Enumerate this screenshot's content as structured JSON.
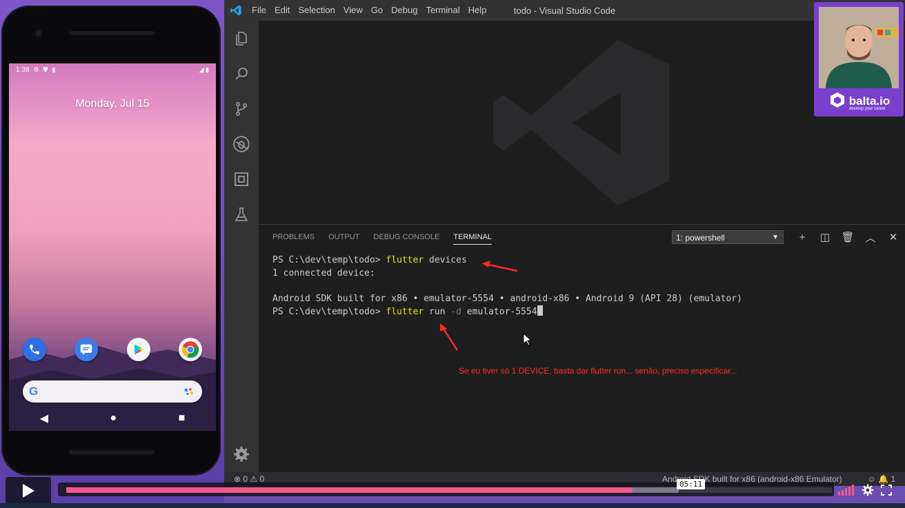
{
  "phone": {
    "status_time": "1:38",
    "date": "Monday, Jul 15",
    "apps": [
      {
        "name": "phone-app-icon",
        "color": "#2f6fe0"
      },
      {
        "name": "messages-app-icon",
        "color": "#3c7bea"
      },
      {
        "name": "play-store-app-icon",
        "color": "#f4f4f4"
      },
      {
        "name": "chrome-app-icon",
        "color": "#f4f4f4"
      }
    ],
    "search_logo": "G"
  },
  "vscode": {
    "menu": [
      "File",
      "Edit",
      "Selection",
      "View",
      "Go",
      "Debug",
      "Terminal",
      "Help"
    ],
    "window_title": "todo - Visual Studio Code",
    "panel_tabs": [
      "PROBLEMS",
      "OUTPUT",
      "DEBUG CONSOLE",
      "TERMINAL"
    ],
    "active_tab": "TERMINAL",
    "terminal_select": "1: powershell",
    "terminal": {
      "line1_prompt": "PS C:\\dev\\temp\\todo> ",
      "line1_cmd": "flutter",
      "line1_arg": " devices",
      "line2": "1 connected device:",
      "line3": "",
      "line4": "Android SDK built for x86 • emulator-5554 • android-x86 • Android 9 (API 28) (emulator)",
      "line5_prompt": "PS C:\\dev\\temp\\todo> ",
      "line5_cmd": "flutter",
      "line5_run": " run ",
      "line5_flag": "-d",
      "line5_arg": " emulator-5554"
    },
    "annotation": "Se eu tiver só 1 DEVICE, basta dar flutter run... senão, preciso especificar...",
    "status_left": "⊗ 0 ⚠ 0",
    "status_mid": "Android SDK built for x86 (android-x86 Emulator)",
    "status_right": "☺ 🔔 1",
    "accent": "#007acc"
  },
  "webcam": {
    "brand": "balta.io",
    "tagline": "develop your career"
  },
  "player": {
    "time": "05:11",
    "progress": 0.74,
    "buffered": 0.8,
    "progress_color": "#f2588a"
  }
}
